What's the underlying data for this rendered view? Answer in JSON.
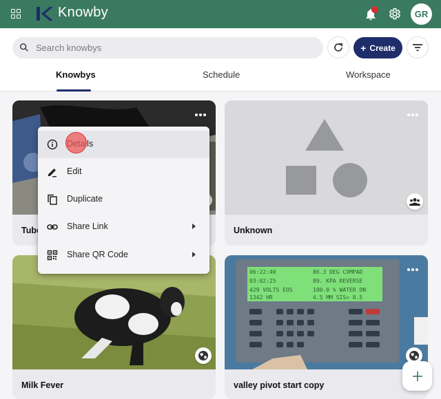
{
  "app": {
    "name": "Knowby",
    "brand_color": "#3a7a61",
    "accent_color": "#1f2d6b"
  },
  "topbar": {
    "menu_icon": "apps-grid-icon",
    "notifications_icon": "bell-icon",
    "settings_icon": "gear-icon",
    "avatar_initials": "GR"
  },
  "search": {
    "placeholder": "Search knowbys",
    "value": ""
  },
  "toolbar": {
    "create_label": "Create",
    "refresh_icon": "refresh-icon",
    "filter_icon": "filter-icon"
  },
  "tabs": [
    {
      "label": "Knowbys",
      "active": true
    },
    {
      "label": "Schedule",
      "active": false
    },
    {
      "label": "Workspace",
      "active": false
    }
  ],
  "cards": [
    {
      "title": "Tube",
      "image": "photo-person-with-cow"
    },
    {
      "title": "Unknown",
      "image": "placeholder-shapes",
      "badge": "group-icon"
    },
    {
      "title": "Milk Fever",
      "image": "photo-cow-lying-in-grass",
      "badge": "globe-icon"
    },
    {
      "title": "valley pivot start copy",
      "image": "photo-control-panel-display",
      "badge": "globe-icon"
    }
  ],
  "context_menu": {
    "items": [
      {
        "label": "Details",
        "icon": "info-icon",
        "submenu": false
      },
      {
        "label": "Edit",
        "icon": "edit-icon",
        "submenu": false
      },
      {
        "label": "Duplicate",
        "icon": "copy-icon",
        "submenu": false
      },
      {
        "label": "Share Link",
        "icon": "link-icon",
        "submenu": true
      },
      {
        "label": "Share QR Code",
        "icon": "qr-code-icon",
        "submenu": true
      }
    ]
  },
  "fab": {
    "icon": "plus-icon"
  }
}
